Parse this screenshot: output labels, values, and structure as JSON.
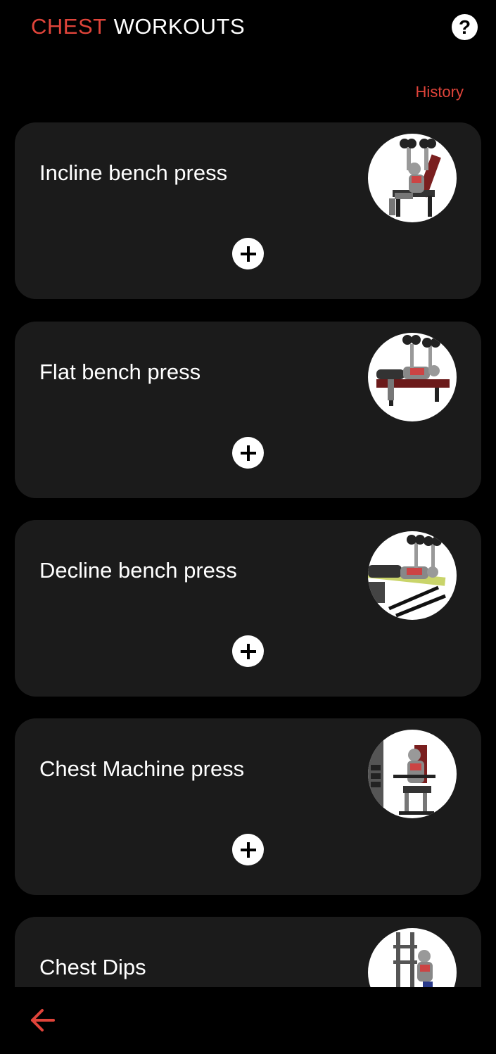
{
  "header": {
    "title_accent": "CHEST",
    "title_rest": "WORKOUTS",
    "help_label": "?"
  },
  "history_label": "History",
  "colors": {
    "accent": "#e0443a",
    "card": "#1b1b1b",
    "background": "#000000"
  },
  "workouts": [
    {
      "name": "Incline bench press",
      "image_icon": "incline-press-illustration"
    },
    {
      "name": "Flat bench press",
      "image_icon": "flat-press-illustration"
    },
    {
      "name": "Decline bench press",
      "image_icon": "decline-press-illustration"
    },
    {
      "name": "Chest Machine press",
      "image_icon": "machine-press-illustration"
    },
    {
      "name": "Chest Dips",
      "image_icon": "dips-illustration"
    }
  ],
  "add_icon": "plus-icon",
  "back_icon": "arrow-left-icon"
}
